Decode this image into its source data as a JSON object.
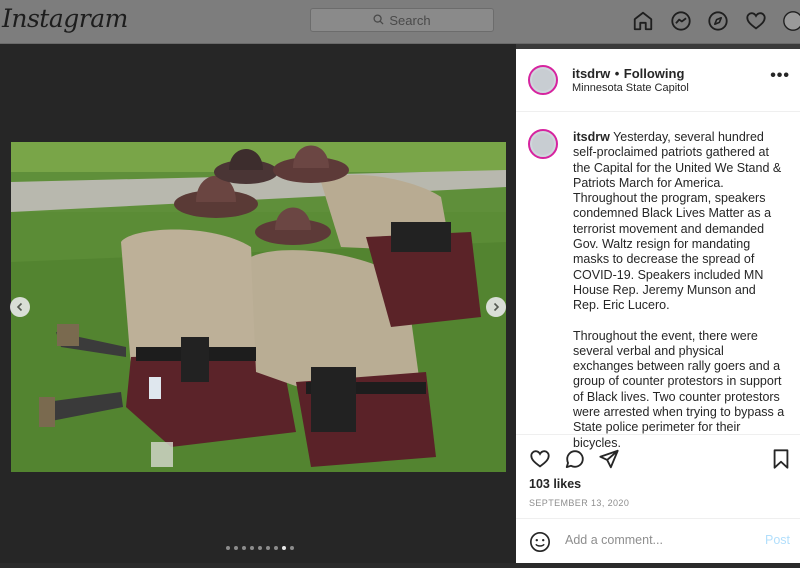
{
  "app": {
    "logo_text": "Instagram"
  },
  "search": {
    "placeholder": "Search"
  },
  "nav": {
    "icons": [
      "home-icon",
      "messenger-icon",
      "explore-icon",
      "heart-icon",
      "profile-avatar"
    ]
  },
  "post": {
    "username": "itsdrw",
    "follow_status": "Following",
    "separator": "•",
    "location": "Minnesota State Capitol",
    "more_label": "•••",
    "caption_username": "itsdrw",
    "caption_paragraph_1": "Yesterday, several hundred self-proclaimed patriots gathered at the Capital for the United We Stand & Patriots March for America. Throughout the program, speakers condemned Black Lives Matter as a terrorist movement and demanded Gov. Waltz resign for mandating masks to decrease the spread of COVID-19. Speakers included MN House Rep. Jeremy Munson and Rep. Eric Lucero.",
    "caption_paragraph_2": "Throughout the event, there were several verbal and physical exchanges between rally goers and a group of counter protestors in support of Black lives. Two counter protestors were arrested when trying to bypass a State police perimeter for their bicycles.",
    "likes": "103 likes",
    "date": "SEPTEMBER 13, 2020",
    "comment_placeholder": "Add a comment...",
    "post_label": "Post"
  },
  "carousel": {
    "slide_count": 9,
    "active_index": 7
  },
  "colors": {
    "accent": "#0095f6",
    "post_disabled": "#b2dffc",
    "story_ring": "#d6249f"
  }
}
